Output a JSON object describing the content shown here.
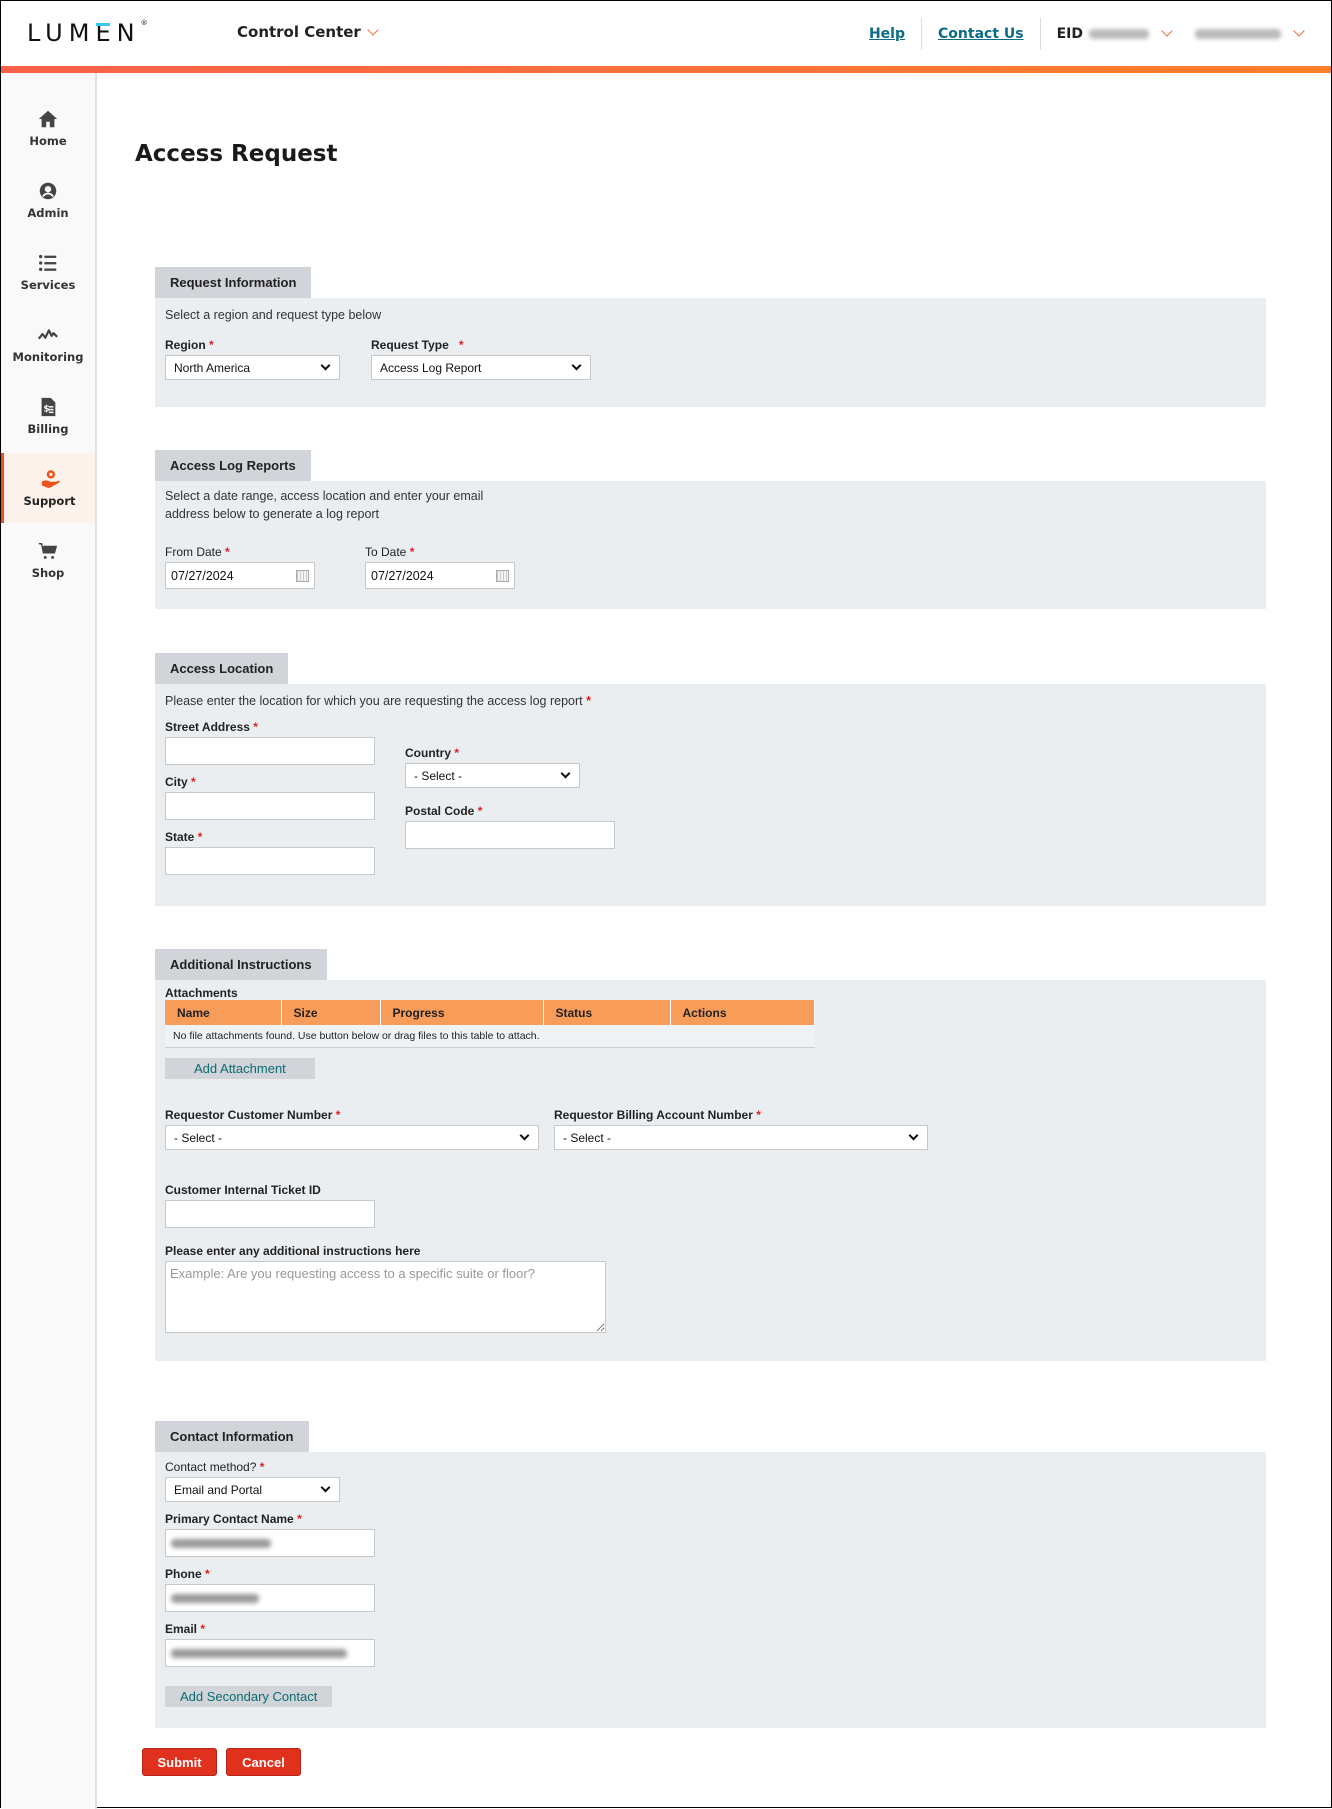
{
  "header": {
    "logo": "LUMEN",
    "app_name": "Control Center",
    "links": {
      "help": "Help",
      "contact": "Contact Us"
    },
    "eid_label": "EID"
  },
  "colors": {
    "accent_start": "#fb6149",
    "accent_end": "#fe7f2a",
    "link": "#0b6c86",
    "required": "#e01e1e",
    "primary_button": "#e0301e",
    "table_header": "#f89c5a"
  },
  "sidebar": {
    "items": [
      {
        "label": "Home",
        "icon": "home-icon"
      },
      {
        "label": "Admin",
        "icon": "user-circle-icon"
      },
      {
        "label": "Services",
        "icon": "list-icon"
      },
      {
        "label": "Monitoring",
        "icon": "pulse-icon"
      },
      {
        "label": "Billing",
        "icon": "invoice-icon"
      },
      {
        "label": "Support",
        "icon": "support-hand-icon",
        "active": true
      },
      {
        "label": "Shop",
        "icon": "cart-icon"
      }
    ]
  },
  "page": {
    "title": "Access Request"
  },
  "request_info": {
    "tab": "Request Information",
    "hint": "Select a region and request type below",
    "region_label": "Region",
    "region_value": "North America",
    "type_label": "Request Type",
    "type_value": "Access Log Report"
  },
  "log_reports": {
    "tab": "Access Log Reports",
    "hint_line1": "Select a date range, access location and enter your email",
    "hint_line2": "address below to generate a log report",
    "from_label": "From Date",
    "from_value": "07/27/2024",
    "to_label": "To Date",
    "to_value": "07/27/2024"
  },
  "location": {
    "tab": "Access Location",
    "hint": "Please enter the location for which you are requesting the access log report",
    "street_label": "Street Address",
    "city_label": "City",
    "state_label": "State",
    "country_label": "Country",
    "country_value": "- Select -",
    "postal_label": "Postal Code"
  },
  "additional": {
    "tab": "Additional Instructions",
    "attachments_label": "Attachments",
    "columns": [
      "Name",
      "Size",
      "Progress",
      "Status",
      "Actions"
    ],
    "empty_message": "No file attachments found. Use button below or drag files to this table to attach.",
    "add_attachment": "Add Attachment",
    "customer_number_label": "Requestor Customer Number",
    "customer_number_value": "- Select -",
    "billing_number_label": "Requestor Billing Account Number",
    "billing_number_value": "- Select -",
    "ticket_label": "Customer Internal Ticket ID",
    "instructions_label": "Please enter any additional instructions here",
    "instructions_placeholder": "Example: Are you requesting access to a specific suite or floor?"
  },
  "contact": {
    "tab": "Contact Information",
    "method_label": "Contact method?",
    "method_value": "Email and Portal",
    "name_label": "Primary Contact Name",
    "phone_label": "Phone",
    "email_label": "Email",
    "add_secondary": "Add Secondary Contact"
  },
  "actions": {
    "submit": "Submit",
    "cancel": "Cancel"
  },
  "required_mark": "*"
}
